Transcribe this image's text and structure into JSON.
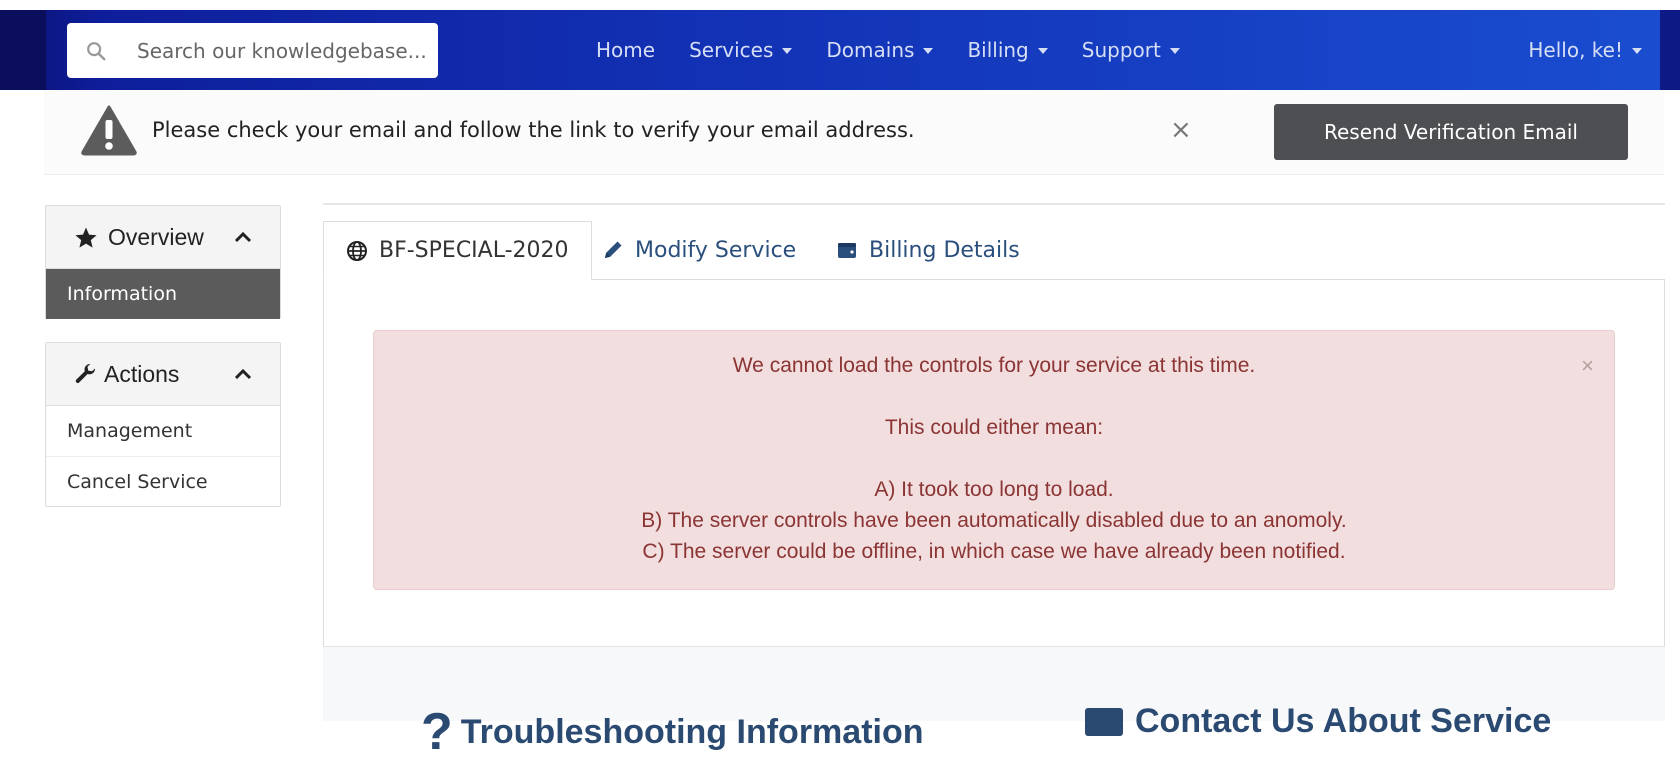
{
  "navbar": {
    "search_placeholder": "Search our knowledgebase...",
    "menu": [
      {
        "label": "Home",
        "has_caret": false
      },
      {
        "label": "Services",
        "has_caret": true
      },
      {
        "label": "Domains",
        "has_caret": true
      },
      {
        "label": "Billing",
        "has_caret": true
      },
      {
        "label": "Support",
        "has_caret": true
      }
    ],
    "user_greeting": "Hello, ke!"
  },
  "verify_banner": {
    "message": "Please check your email and follow the link to verify your email address.",
    "close_glyph": "×",
    "button_label": "Resend Verification Email"
  },
  "sidebar": {
    "overview": {
      "title": "Overview",
      "items": [
        {
          "label": "Information",
          "active": true
        }
      ]
    },
    "actions": {
      "title": "Actions",
      "items": [
        {
          "label": "Management"
        },
        {
          "label": "Cancel Service"
        }
      ]
    }
  },
  "tabs": [
    {
      "label": "BF-SPECIAL-2020",
      "icon": "globe-icon",
      "active": true
    },
    {
      "label": "Modify Service",
      "icon": "pencil-icon",
      "active": false
    },
    {
      "label": "Billing Details",
      "icon": "wallet-icon",
      "active": false
    }
  ],
  "alert": {
    "line1": "We cannot load the controls for your service at this time.",
    "line2": "This could either mean:",
    "line3": "A) It took too long to load.",
    "line4": "B) The server controls have been automatically disabled due to an anomoly.",
    "line5": "C) The server could be offline, in which case we have already been notified.",
    "close_glyph": "×"
  },
  "lower": {
    "troubleshooting_icon_text": "?",
    "troubleshooting_title": "Troubleshooting Information",
    "contact_title": "Contact Us About Service"
  },
  "colors": {
    "navbar": "#1230b3",
    "alert_bg": "#f2dede",
    "alert_text": "#8b3434",
    "button_dark": "#4d4f53",
    "link": "#2a4f7d"
  }
}
